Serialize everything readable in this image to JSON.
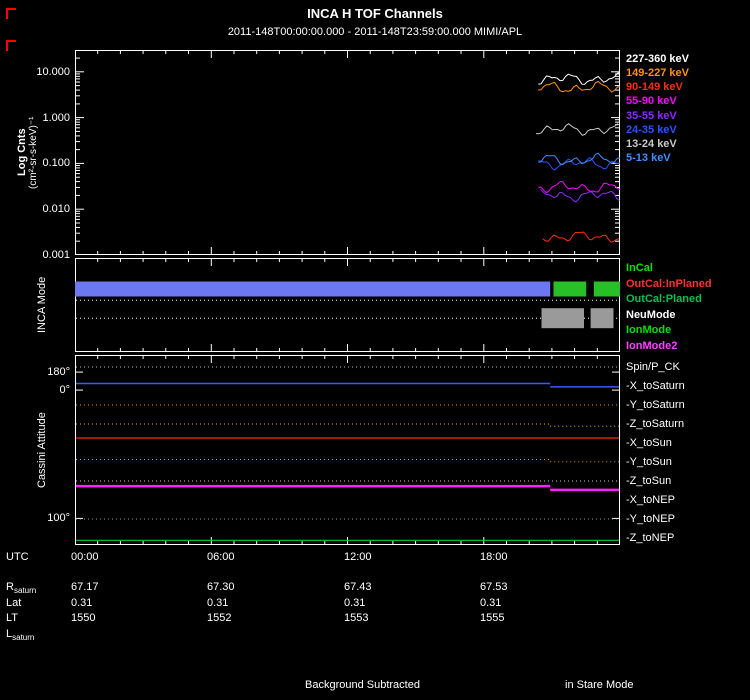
{
  "header": {
    "title": "INCA H TOF Channels",
    "subtitle": "2011-148T00:00:00.000 - 2011-148T23:59:00.000 MIMI/APL"
  },
  "decorations": {
    "corner_marker_color": "#ff0000"
  },
  "axis": {
    "utc_label": "UTC",
    "utc_ticks": [
      "00:00",
      "06:00",
      "12:00",
      "18:00"
    ]
  },
  "ephemeris": {
    "rows": [
      {
        "label": "R",
        "sub": "saturn",
        "values": [
          "67.17",
          "67.30",
          "67.43",
          "67.53"
        ]
      },
      {
        "label": "Lat",
        "sub": "",
        "values": [
          "0.31",
          "0.31",
          "0.31",
          "0.31"
        ]
      },
      {
        "label": "LT",
        "sub": "",
        "values": [
          "1550",
          "1552",
          "1553",
          "1555"
        ]
      },
      {
        "label": "L",
        "sub": "saturn",
        "values": [
          "",
          "",
          "",
          ""
        ]
      }
    ]
  },
  "footer": {
    "background_note": "Background Subtracted",
    "stare_note": "in Stare Mode"
  },
  "chart_data": [
    {
      "type": "line",
      "panel": "tof-flux",
      "ylabel": "Log Cnts",
      "ylabel_units": "(cm²-sr-s-keV)⁻¹",
      "yscale": "log",
      "ylim": [
        0.001,
        30
      ],
      "yticks": [
        "10.000",
        "1.000",
        "0.100",
        "0.010",
        "0.001"
      ],
      "ytick_values": [
        10,
        1,
        0.1,
        0.01,
        0.001
      ],
      "xlim_hours": [
        0,
        24
      ],
      "note": "flux traces present only after ~20:20 UT (stare mode interval at right edge)",
      "series": [
        {
          "name": "227-360 keV",
          "color": "#ffffff",
          "start_hour": 20.4,
          "level": 7.0
        },
        {
          "name": "149-227 keV",
          "color": "#ff9100",
          "start_hour": 20.4,
          "level": 4.5
        },
        {
          "name": "90-149 keV",
          "color": "#ff2d00",
          "start_hour": 20.6,
          "level": 0.0025
        },
        {
          "name": "55-90 keV",
          "color": "#ff00ff",
          "start_hour": 20.4,
          "level": 0.03
        },
        {
          "name": "35-55 keV",
          "color": "#8a2bff",
          "start_hour": 20.5,
          "level": 0.02
        },
        {
          "name": "24-35 keV",
          "color": "#2a52ff",
          "start_hour": 20.4,
          "level": 0.1
        },
        {
          "name": "13-24 keV",
          "color": "#c8c8c8",
          "start_hour": 20.3,
          "level": 0.55
        },
        {
          "name": "5-13 keV",
          "color": "#3f8fff",
          "start_hour": 20.4,
          "level": 0.12
        }
      ]
    },
    {
      "type": "mode-timeline",
      "panel": "inca-mode",
      "ylabel": "INCA Mode",
      "labels": [
        {
          "text": "InCal",
          "color": "#00e000"
        },
        {
          "text": "OutCal:InPlaned",
          "color": "#ff3030"
        },
        {
          "text": "OutCal:Planed",
          "color": "#00c050"
        },
        {
          "text": "NeuMode",
          "color": "#ffffff"
        },
        {
          "text": "IonMode",
          "color": "#00e000"
        },
        {
          "text": "IonMode2",
          "color": "#ff40ff"
        }
      ],
      "bars": [
        {
          "label": "OutCal:InPlaned",
          "color": "#6b78f0",
          "x0": 0.0,
          "x1": 0.872,
          "y_frac": 0.33,
          "h": 15
        },
        {
          "label": "OutCal:InPlaned",
          "color": "#27c127",
          "x0": 0.878,
          "x1": 0.938,
          "y_frac": 0.33,
          "h": 15
        },
        {
          "label": "OutCal:InPlaned",
          "color": "#27c127",
          "x0": 0.952,
          "x1": 1.0,
          "y_frac": 0.33,
          "h": 15
        },
        {
          "label": "NeuMode",
          "color": "#9a9a9a",
          "x0": 0.856,
          "x1": 0.934,
          "y_frac": 0.64,
          "h": 20
        },
        {
          "label": "NeuMode",
          "color": "#9a9a9a",
          "x0": 0.946,
          "x1": 0.988,
          "y_frac": 0.64,
          "h": 20
        }
      ],
      "dotted_rows_y_frac": [
        0.45,
        0.64
      ]
    },
    {
      "type": "line",
      "panel": "cassini-attitude",
      "ylabel": "Cassini Attitude",
      "yticks": [
        {
          "label": "180°",
          "y_frac": 0.09
        },
        {
          "label": "0°",
          "y_frac": 0.185
        },
        {
          "label": "100°",
          "y_frac": 0.86
        }
      ],
      "series": [
        {
          "name": "Spin/P_CK",
          "color": "#bbbbbb",
          "style": "dotted",
          "lw": 1,
          "y_frac": 0.063
        },
        {
          "name": "-X_toSaturn",
          "color": "#3a5cff",
          "style": "solid",
          "lw": 1.5,
          "y_frac": 0.15,
          "step_x": 0.872,
          "step_dy": 0.018
        },
        {
          "name": "-Y_toSaturn",
          "color": "#ff9100",
          "style": "dotted",
          "lw": 1,
          "y_frac": 0.263
        },
        {
          "name": "-Z_toSaturn",
          "color": "#ffb400",
          "style": "dotted",
          "lw": 1,
          "y_frac": 0.363,
          "step_x": 0.872,
          "step_dy": 0.012
        },
        {
          "name": "-X_toSun",
          "color": "#ff2d00",
          "style": "solid",
          "lw": 1.2,
          "y_frac": 0.437
        },
        {
          "name": "-Y_toSun",
          "color": "#ff9100",
          "style": "dotted",
          "lw": 1,
          "y_frac": 0.55,
          "step_x": 0.872,
          "step_dy": 0.012
        },
        {
          "name": "-Z_toSun",
          "color": "#cccccc",
          "style": "dotted",
          "lw": 1,
          "y_frac": 0.663
        },
        {
          "name": "-X_toNEP",
          "color": "#ff20ff",
          "style": "solid",
          "lw": 2.5,
          "y_frac": 0.69,
          "step_x": 0.872,
          "step_dy": 0.02
        },
        {
          "name": "-Y_toNEP",
          "color": "#9a9a9a",
          "style": "dotted",
          "lw": 1,
          "y_frac": 0.863
        },
        {
          "name": "-Z_toNEP",
          "color": "#00cc33",
          "style": "solid",
          "lw": 1.2,
          "y_frac": 0.975
        }
      ]
    }
  ]
}
